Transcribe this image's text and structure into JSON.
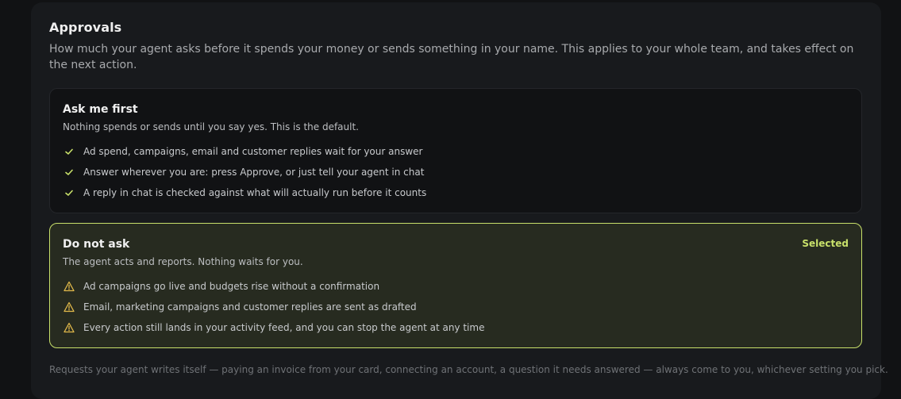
{
  "section": {
    "title": "Approvals",
    "description": "How much your agent asks before it spends your money or sends something in your name. This applies to your whole team, and takes effect on the next action."
  },
  "options": [
    {
      "title": "Ask me first",
      "subtitle": "Nothing spends or sends until you say yes. This is the default.",
      "items": [
        {
          "icon": "check-icon",
          "text": "Ad spend, campaigns, email and customer replies wait for your answer"
        },
        {
          "icon": "check-icon",
          "text": "Answer wherever you are: press Approve, or just tell your agent in chat"
        },
        {
          "icon": "check-icon",
          "text": "A reply in chat is checked against what will actually run before it counts"
        }
      ]
    },
    {
      "title": "Do not ask",
      "subtitle": "The agent acts and reports. Nothing waits for you.",
      "badge": "Selected",
      "items": [
        {
          "icon": "warning-icon",
          "text": "Ad campaigns go live and budgets rise without a confirmation"
        },
        {
          "icon": "warning-icon",
          "text": "Email, marketing campaigns and customer replies are sent as drafted"
        },
        {
          "icon": "warning-icon",
          "text": "Every action still lands in your activity feed, and you can stop the agent at any time"
        }
      ]
    }
  ],
  "footnote": "Requests your agent writes itself — paying an invoice from your card, connecting an account, a question it needs answered — always come to you, whichever setting you pick.",
  "colors": {
    "accent": "#c8e06a",
    "warning": "#e0b84a",
    "background": "#111214",
    "panel": "#181a1d"
  }
}
